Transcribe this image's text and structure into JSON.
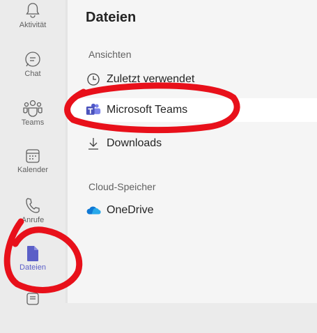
{
  "rail": {
    "items": [
      {
        "label": "Aktivität",
        "icon": "bell-icon"
      },
      {
        "label": "Chat",
        "icon": "chat-icon"
      },
      {
        "label": "Teams",
        "icon": "teams-icon"
      },
      {
        "label": "Kalender",
        "icon": "calendar-icon"
      },
      {
        "label": "Anrufe",
        "icon": "phone-icon"
      },
      {
        "label": "Dateien",
        "icon": "file-icon",
        "active": true
      },
      {
        "label": "",
        "icon": "more-apps-icon"
      }
    ]
  },
  "panel": {
    "title": "Dateien",
    "views_heading": "Ansichten",
    "views": [
      {
        "label": "Zuletzt verwendet",
        "icon": "clock-icon"
      },
      {
        "label": "Microsoft Teams",
        "icon": "teams-logo-icon",
        "selected": true
      },
      {
        "label": "Downloads",
        "icon": "download-icon"
      }
    ],
    "cloud_heading": "Cloud-Speicher",
    "cloud": [
      {
        "label": "OneDrive",
        "icon": "onedrive-icon"
      }
    ]
  },
  "colors": {
    "accent": "#5b5fc7",
    "annotation": "#e8101a",
    "onedrive": "#0f78d4"
  }
}
